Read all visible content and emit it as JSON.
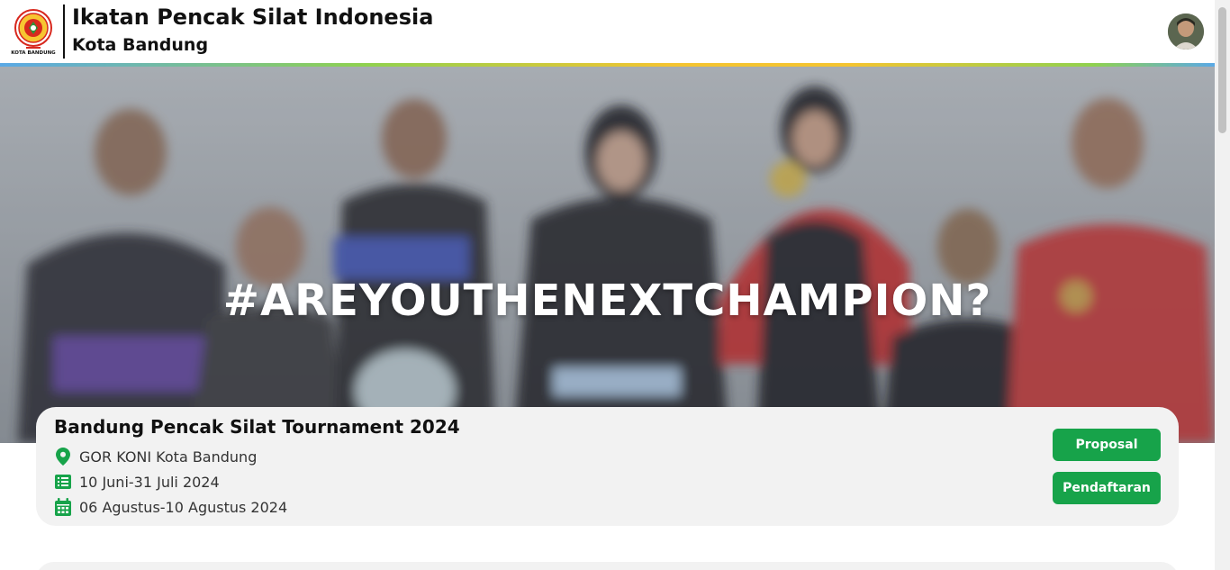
{
  "header": {
    "logo_alt": "KOTA BANDUNG",
    "org_name": "Ikatan Pencak Silat Indonesia",
    "org_city": "Kota Bandung"
  },
  "hero": {
    "title": "#AREYOUTHENEXTCHAMPION?"
  },
  "event": {
    "title": "Bandung Pencak Silat Tournament 2024",
    "venue": "GOR KONI Kota Bandung",
    "registration_period": "10 Juni-31 Juli 2024",
    "event_dates": "06 Agustus-10 Agustus 2024",
    "buttons": {
      "proposal": "Proposal",
      "register": "Pendaftaran"
    }
  },
  "icons": {
    "location": "map-pin-icon",
    "registration": "list-icon",
    "date": "calendar-icon"
  },
  "colors": {
    "accent_green": "#17a34a",
    "card_bg": "#f2f2f2"
  }
}
